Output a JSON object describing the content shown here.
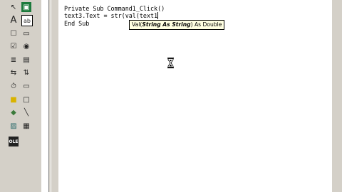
{
  "toolbox": {
    "tools": [
      {
        "name": "pointer-icon",
        "glyph": "↖"
      },
      {
        "name": "picturebox-icon",
        "glyph": "▣"
      },
      {
        "name": "label-icon",
        "glyph": "A"
      },
      {
        "name": "textbox-icon",
        "glyph": "ab"
      },
      {
        "name": "frame-icon",
        "glyph": "☐"
      },
      {
        "name": "commandbutton-icon",
        "glyph": "▭"
      },
      {
        "name": "checkbox-icon",
        "glyph": "☑"
      },
      {
        "name": "optionbutton-icon",
        "glyph": "◉"
      },
      {
        "name": "combobox-icon",
        "glyph": "≣"
      },
      {
        "name": "listbox-icon",
        "glyph": "▤"
      },
      {
        "name": "hscrollbar-icon",
        "glyph": "⇆"
      },
      {
        "name": "vscrollbar-icon",
        "glyph": "⇅"
      },
      {
        "name": "timer-icon",
        "glyph": "⏱"
      },
      {
        "name": "drivelistbox-icon",
        "glyph": "▭"
      },
      {
        "name": "dirlistbox-icon",
        "glyph": "■"
      },
      {
        "name": "filelistbox-icon",
        "glyph": "□"
      },
      {
        "name": "shape-icon",
        "glyph": "◆"
      },
      {
        "name": "line-icon",
        "glyph": "╲"
      },
      {
        "name": "image-icon",
        "glyph": "▨"
      },
      {
        "name": "data-icon",
        "glyph": "▦"
      },
      {
        "name": "ole-icon",
        "glyph": "OLE"
      }
    ]
  },
  "editor": {
    "lines": [
      "Private Sub Command1_Click()",
      "text3.Text = str(val(text1",
      "End Sub"
    ]
  },
  "tooltip": {
    "prefix": "Val(",
    "param": "String As String",
    "suffix": ") As Double"
  }
}
